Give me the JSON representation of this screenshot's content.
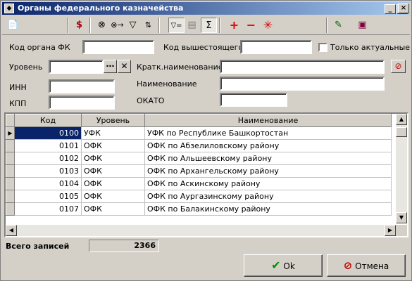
{
  "window": {
    "title": "Органы федерального казначейства",
    "minimize": "_",
    "maximize": "□",
    "close": "×"
  },
  "toolbar": {
    "icons": [
      "document-icon",
      "money-icon",
      "binoculars-icon",
      "find-next-icon",
      "filter-icon",
      "sort-icon",
      "filter-equal-icon",
      "record-icon",
      "sum-icon",
      "plus-icon",
      "minus-icon",
      "asterisk-icon",
      "pin-icon",
      "book-icon"
    ]
  },
  "filters": {
    "code_label": "Код органа ФК",
    "code_value": "",
    "parent_label": "Код вышестоящего",
    "parent_value": "",
    "actual_label": "Только актуальные",
    "level_label": "Уровень",
    "level_value": "",
    "short_label": "Кратк.наименование",
    "short_value": "",
    "inn_label": "ИНН",
    "inn_value": "",
    "name_label": "Наименование",
    "name_value": "",
    "kpp_label": "КПП",
    "kpp_value": "",
    "okato_label": "ОКАТО",
    "okato_value": ""
  },
  "table": {
    "headers": [
      "Код",
      "Уровень",
      "Наименование"
    ],
    "rows": [
      [
        "0100",
        "УФК",
        "УФК по Республике Башкортостан"
      ],
      [
        "0101",
        "ОФК",
        "ОФК по Абзелиловскому району"
      ],
      [
        "0102",
        "ОФК",
        "ОФК по Альшеевскому району"
      ],
      [
        "0103",
        "ОФК",
        "ОФК по Архангельскому району"
      ],
      [
        "0104",
        "ОФК",
        "ОФК по Аскинскому району"
      ],
      [
        "0105",
        "ОФК",
        "ОФК по Аургазинскому району"
      ],
      [
        "0107",
        "ОФК",
        "ОФК по Балакинскому району"
      ]
    ]
  },
  "footer": {
    "total_label": "Всего записей",
    "total_value": "2366",
    "ok_label": "Ok",
    "cancel_label": "Отмена"
  }
}
